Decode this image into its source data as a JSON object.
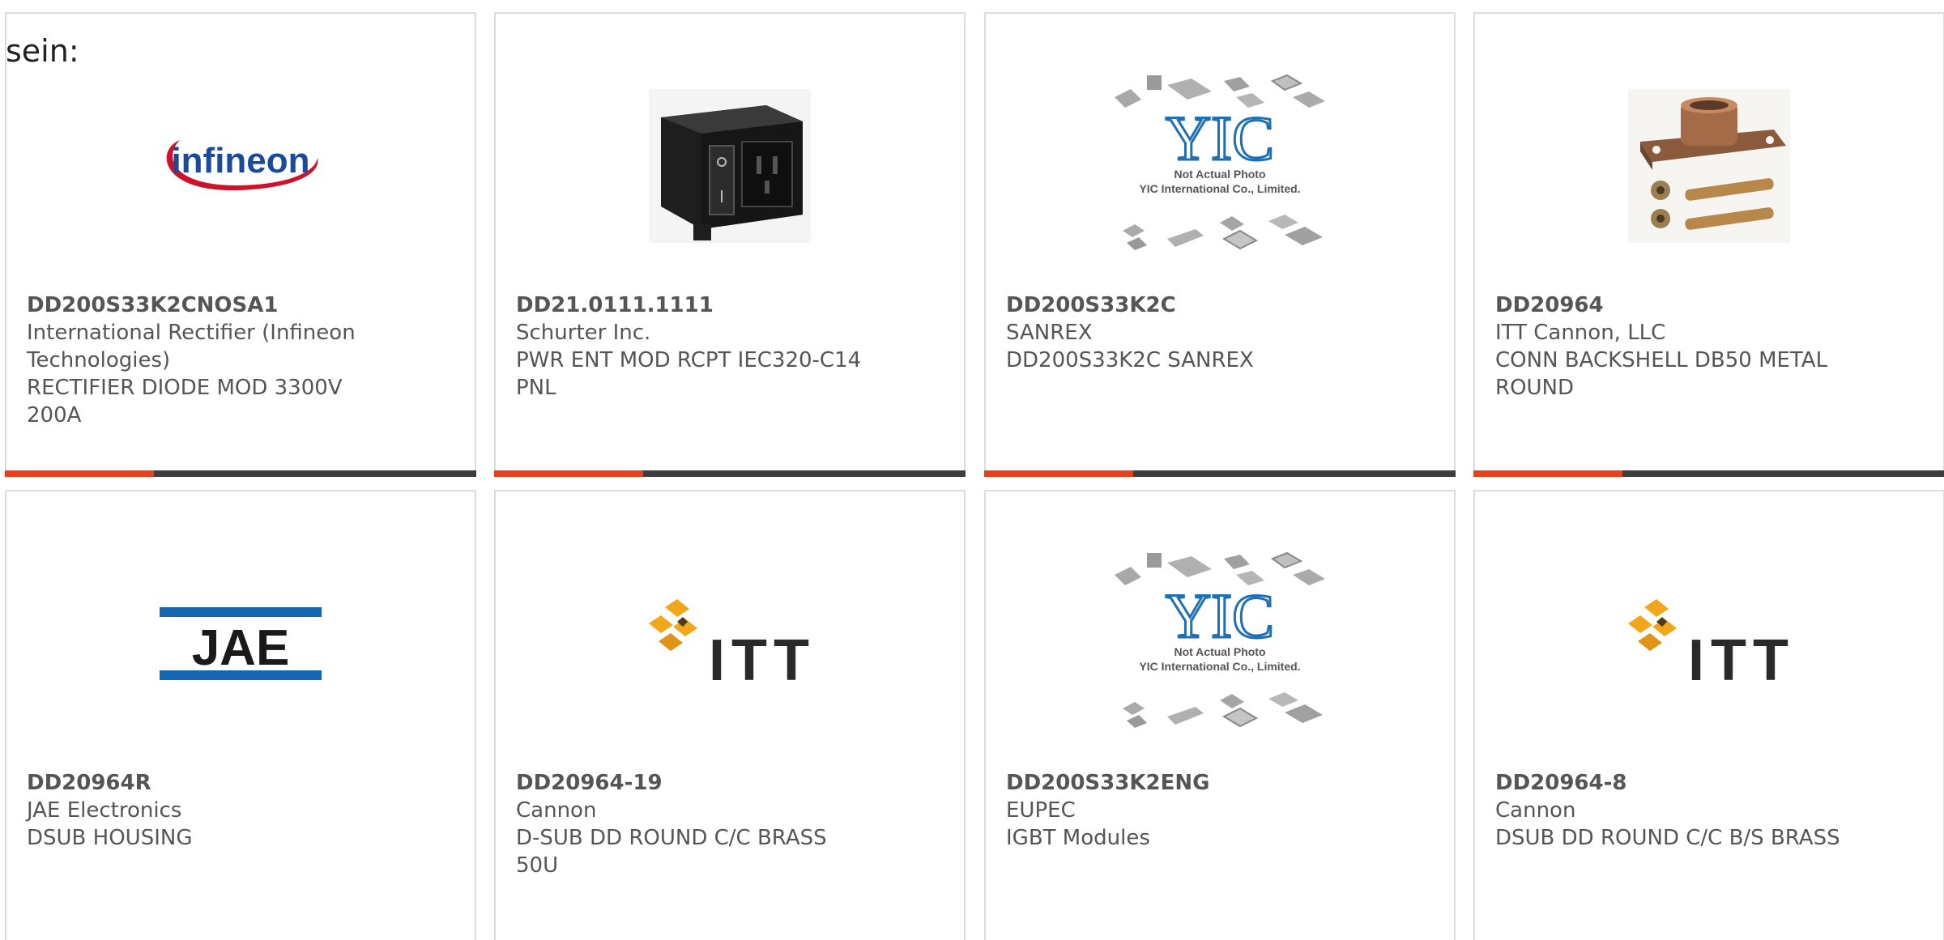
{
  "intro_text": "sein:",
  "colors": {
    "accent": "#e8401c",
    "bar": "#3d3d3d",
    "text": "#555555",
    "border": "#dcdcdc",
    "infineon_red": "#d0112b",
    "infineon_blue": "#1a4b9a",
    "jae_blue": "#1565b0",
    "itt_gold": "#f2a71b"
  },
  "products": [
    {
      "part": "DD200S33K2CNOSA1",
      "manufacturer": "International Rectifier (Infineon Technologies)",
      "description": "RECTIFIER DIODE MOD 3300V 200A",
      "image": "infineon-logo",
      "logo_text": "infineon"
    },
    {
      "part": "DD21.0111.1111",
      "manufacturer": "Schurter Inc.",
      "description": "PWR ENT MOD RCPT IEC320-C14 PNL",
      "image": "power-entry-module-photo"
    },
    {
      "part": "DD200S33K2C",
      "manufacturer": "SANREX",
      "description": "DD200S33K2C SANREX",
      "image": "yic-placeholder",
      "placeholder_line1": "Not Actual Photo",
      "placeholder_line2": "YIC International Co., Limited."
    },
    {
      "part": "DD20964",
      "manufacturer": "ITT Cannon, LLC",
      "description": "CONN BACKSHELL DB50 METAL ROUND",
      "image": "backshell-photo"
    },
    {
      "part": "DD20964R",
      "manufacturer": "JAE Electronics",
      "description": "DSUB HOUSING",
      "image": "jae-logo",
      "logo_text": "JAE"
    },
    {
      "part": "DD20964-19",
      "manufacturer": "Cannon",
      "description": "D-SUB DD ROUND C/C BRASS 50U",
      "image": "itt-logo",
      "logo_text": "ITT"
    },
    {
      "part": "DD200S33K2ENG",
      "manufacturer": "EUPEC",
      "description": "IGBT Modules",
      "image": "yic-placeholder",
      "placeholder_line1": "Not Actual Photo",
      "placeholder_line2": "YIC International Co., Limited."
    },
    {
      "part": "DD20964-8",
      "manufacturer": "Cannon",
      "description": "DSUB DD ROUND C/C B/S BRASS",
      "image": "itt-logo",
      "logo_text": "ITT"
    }
  ]
}
